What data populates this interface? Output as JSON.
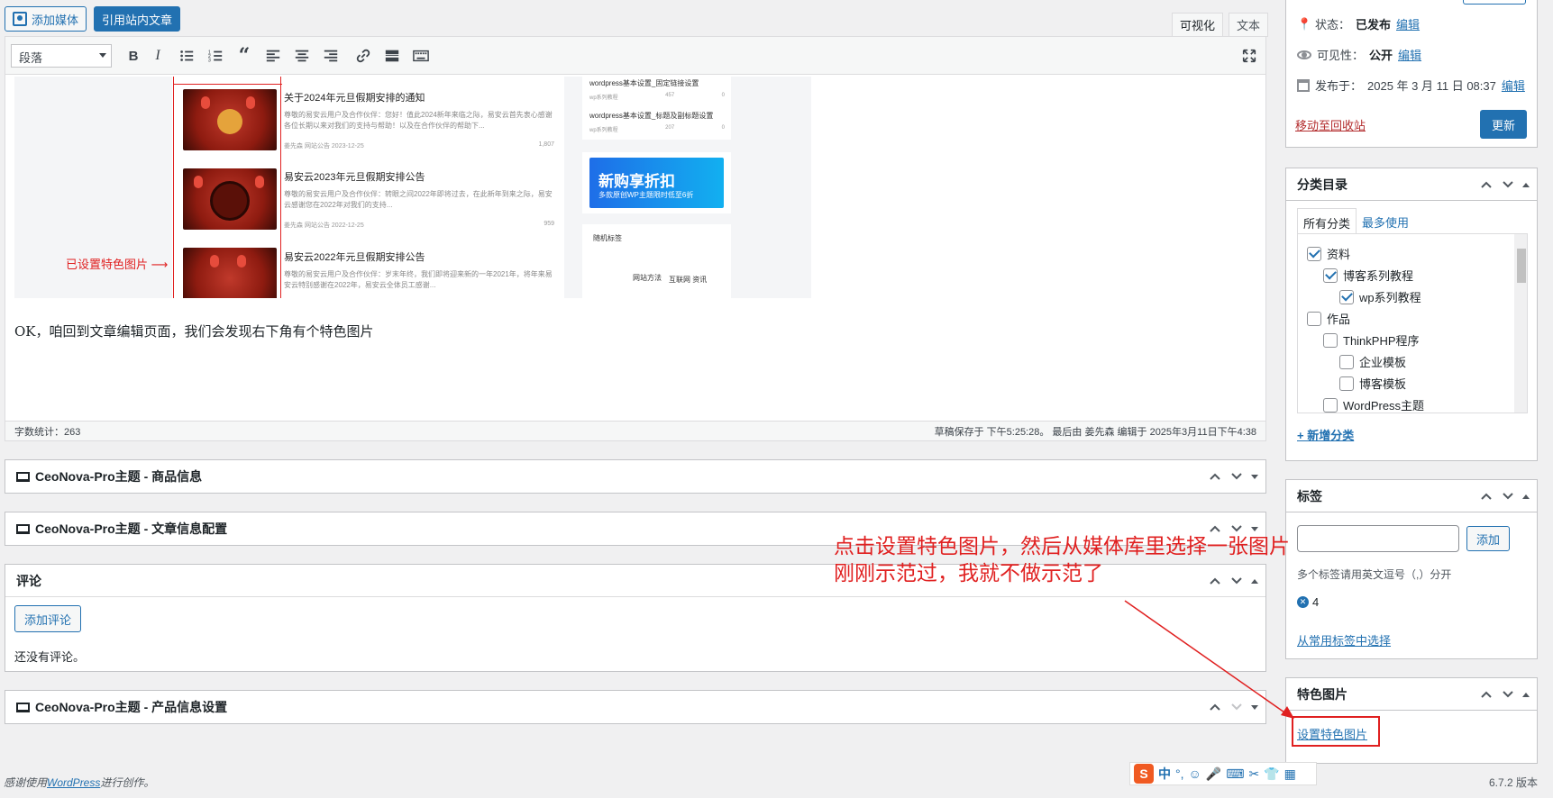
{
  "media_buttons": {
    "add_media": "添加媒体",
    "cite_post": "引用站内文章"
  },
  "editor": {
    "tab_visual": "可视化",
    "tab_text": "文本",
    "format_select": "段落",
    "body_text": "OK，咱回到文章编辑页面，我们会发现右下角有个特色图片",
    "word_count": "字数统计：263",
    "draft_saved": "草稿保存于 下午5:25:28。 最后由 姜先森 编辑于 2025年3月11日下午4:38"
  },
  "embedded_screenshot": {
    "annotation": "已设置特色图片 ⟶",
    "posts": [
      {
        "title": "关于2024年元旦假期安排的通知",
        "desc": "尊敬的易安云用户及合作伙伴：您好！值此2024新年来临之际，易安云首先衷心感谢各位长期以来对我们的支持与帮助！以及在合作伙伴的帮助下...",
        "author": "姜先森",
        "cat": "网站公告",
        "date": "2023-12-25",
        "views": "1,807"
      },
      {
        "title": "易安云2023年元旦假期安排公告",
        "desc": "尊敬的易安云用户及合作伙伴：转眼之间2022年即将过去，在此新年到来之际，易安云感谢您在2022年对我们的支持...",
        "author": "姜先森",
        "cat": "网站公告",
        "date": "2022-12-25",
        "views": "959"
      },
      {
        "title": "易安云2022年元旦假期安排公告",
        "desc": "尊敬的易安云用户及合作伙伴：岁末年终，我们即将迎来新的一年2021年，将年来易安云特别感谢在2022年，易安云全体员工感谢...",
        "author": "",
        "cat": "",
        "date": "",
        "views": ""
      }
    ],
    "side_items": [
      {
        "title": "wordpress基本设置_固定链接设置",
        "cat": "wp系列教程",
        "num": "457",
        "c": "0"
      },
      {
        "title": "wordpress基本设置_标题及副标题设置",
        "cat": "wp系列教程",
        "num": "207",
        "c": "0"
      }
    ],
    "banner_title": "新购享折扣",
    "banner_sub": "多款原创WP主题限时低至6折",
    "tags_card_title": "随机标签",
    "tags_card_tags": [
      "网站方法",
      "互联网 资讯"
    ]
  },
  "metaboxes": {
    "product_info": "CeoNova-Pro主题 - 商品信息",
    "article_config": "CeoNova-Pro主题 - 文章信息配置",
    "comments": {
      "title": "评论",
      "add_button": "添加评论",
      "empty": "还没有评论。"
    },
    "product_settings": "CeoNova-Pro主题 - 产品信息设置"
  },
  "publish": {
    "status_label": "状态：",
    "status_value": "已发布",
    "visibility_label": "可见性：",
    "visibility_value": "公开",
    "published_label": "发布于：",
    "published_value": "2025 年 3 月 11 日 08:37",
    "edit": "编辑",
    "trash": "移动至回收站",
    "update": "更新"
  },
  "categories": {
    "title": "分类目录",
    "tab_all": "所有分类",
    "tab_popular": "最多使用",
    "items": [
      {
        "label": "资料",
        "checked": true,
        "level": 0
      },
      {
        "label": "博客系列教程",
        "checked": true,
        "level": 1
      },
      {
        "label": "wp系列教程",
        "checked": true,
        "level": 2
      },
      {
        "label": "作品",
        "checked": false,
        "level": 0
      },
      {
        "label": "ThinkPHP程序",
        "checked": false,
        "level": 1
      },
      {
        "label": "企业模板",
        "checked": false,
        "level": 2
      },
      {
        "label": "博客模板",
        "checked": false,
        "level": 2
      },
      {
        "label": "WordPress主题",
        "checked": false,
        "level": 1
      }
    ],
    "add_new": "+ 新增分类"
  },
  "tags": {
    "title": "标签",
    "add_button": "添加",
    "hint": "多个标签请用英文逗号（,）分开",
    "tag_value": "4",
    "choose_popular": "从常用标签中选择"
  },
  "featured_image": {
    "title": "特色图片",
    "set_link": "设置特色图片"
  },
  "annotation": {
    "line1": "点击设置特色图片，然后从媒体库里选择一张图片",
    "line2": "刚刚示范过，我就不做示范了"
  },
  "footer": {
    "thanks_prefix": "感谢使用",
    "wordpress": "WordPress",
    "thanks_suffix": "进行创作。",
    "version": "6.7.2 版本"
  },
  "ime_bar": {
    "lang": "中"
  },
  "colors": {
    "accent": "#2271b1",
    "annotation": "#e02020"
  }
}
